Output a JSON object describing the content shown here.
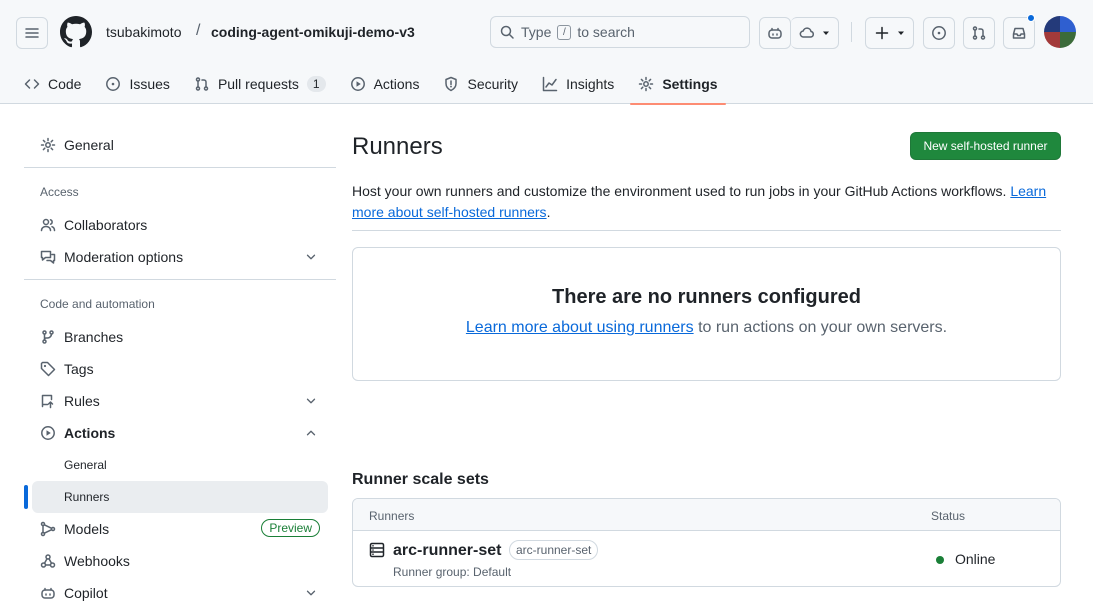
{
  "header": {
    "owner": "tsubakimoto",
    "separator": "/",
    "repo": "coding-agent-omikuji-demo-v3",
    "search_prefix": "Type",
    "search_key": "/",
    "search_suffix": "to search"
  },
  "tabs": [
    {
      "label": "Code",
      "icon": "code-icon"
    },
    {
      "label": "Issues",
      "icon": "issue-icon"
    },
    {
      "label": "Pull requests",
      "icon": "pull-request-icon",
      "count": "1"
    },
    {
      "label": "Actions",
      "icon": "play-icon"
    },
    {
      "label": "Security",
      "icon": "shield-icon"
    },
    {
      "label": "Insights",
      "icon": "graph-icon"
    },
    {
      "label": "Settings",
      "icon": "gear-icon",
      "selected": true
    }
  ],
  "sidebar": {
    "general": "General",
    "access_heading": "Access",
    "collaborators": "Collaborators",
    "moderation": "Moderation options",
    "code_heading": "Code and automation",
    "branches": "Branches",
    "tags": "Tags",
    "rules": "Rules",
    "actions": "Actions",
    "actions_general": "General",
    "actions_runners": "Runners",
    "models": "Models",
    "models_badge": "Preview",
    "webhooks": "Webhooks",
    "copilot": "Copilot"
  },
  "main": {
    "title": "Runners",
    "new_button": "New self-hosted runner",
    "description": "Host your own runners and customize the environment used to run jobs in your GitHub Actions workflows.",
    "description_link": "Learn more about self-hosted runners",
    "blank_title": "There are no runners configured",
    "blank_link": "Learn more about using runners",
    "blank_text": "to run actions on your own servers.",
    "scale_sets_title": "Runner scale sets",
    "table_headers": {
      "runners": "Runners",
      "status": "Status"
    },
    "runner": {
      "name": "arc-runner-set",
      "label": "arc-runner-set",
      "group": "Runner group: Default",
      "status": "Online"
    }
  },
  "colors": {
    "primary_button": "#1f883d",
    "link": "#0969da",
    "online": "#1a7f37",
    "active_tab_underline": "#fd8c73"
  }
}
